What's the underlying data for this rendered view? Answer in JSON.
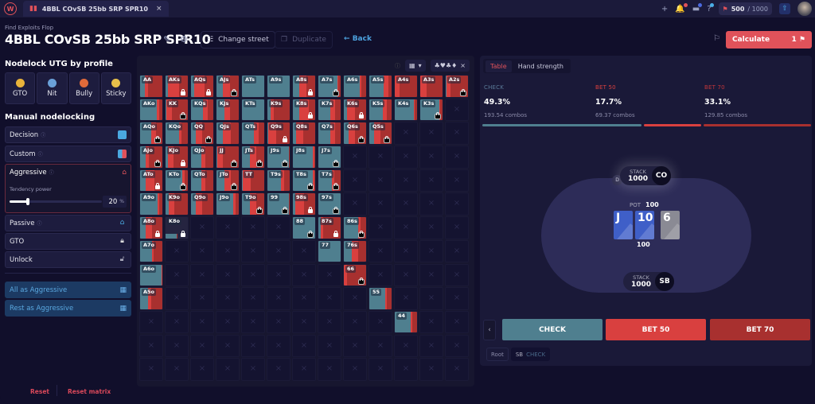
{
  "app": {
    "logo": "W",
    "tab": {
      "icon": "chart-icon",
      "title": "4BBL COvSB 25bb SRP SPR10",
      "close": "×"
    },
    "credits": {
      "used": "500",
      "max": "/ 1000"
    }
  },
  "header": {
    "subtitle": "Find Exploits Flop",
    "title": "4BBL COvSB 25bb SRP SPR10",
    "change_street": "Change street",
    "duplicate": "Duplicate",
    "back": "Back",
    "calculate": "Calculate",
    "calculate_count": "1"
  },
  "left": {
    "profile_heading": "Nodelock UTG by profile",
    "profiles": [
      {
        "label": "GTO",
        "emoji": "😎",
        "color": "#e8b33a"
      },
      {
        "label": "Nit",
        "emoji": "😱",
        "color": "#6aa0d8"
      },
      {
        "label": "Bully",
        "emoji": "😡",
        "color": "#e06a3a"
      },
      {
        "label": "Sticky",
        "emoji": "😬",
        "color": "#e8c04a"
      }
    ],
    "manual_heading": "Manual nodelocking",
    "rows": {
      "decision": "Decision",
      "custom": "Custom",
      "aggressive": "Aggressive",
      "passive": "Passive",
      "gto": "GTO",
      "unlock": "Unlock"
    },
    "tendency_label": "Tendency power",
    "tendency_value": "20",
    "tendency_unit": "%",
    "tendency_fraction": 0.2,
    "all_as": "All as Aggressive",
    "rest_as": "Rest as Aggressive",
    "reset": "Reset",
    "reset_matrix": "Reset matrix"
  },
  "matrix": {
    "colors": {
      "check": "#4f7f8f",
      "bet50": "#d9403f",
      "bet70": "#a8302f"
    },
    "rows": [
      [
        [
          "AA",
          0.2,
          0.15,
          0.65,
          ""
        ],
        [
          "AKs",
          0.1,
          0.5,
          0.4,
          "w"
        ],
        [
          "AQs",
          0.15,
          0.45,
          0.4,
          "w"
        ],
        [
          "AJs",
          0.3,
          0.3,
          0.4,
          "b"
        ],
        [
          "ATs",
          1,
          0,
          0,
          ""
        ],
        [
          "A9s",
          1,
          0,
          0,
          ""
        ],
        [
          "A8s",
          0.3,
          0.3,
          0.4,
          "w"
        ],
        [
          "A7s",
          0.85,
          0.05,
          0.1,
          "b"
        ],
        [
          "A6s",
          0.7,
          0.1,
          0.2,
          ""
        ],
        [
          "A5s",
          0.65,
          0.2,
          0.15,
          ""
        ],
        [
          "A4s",
          0,
          0.2,
          0.8,
          ""
        ],
        [
          "A3s",
          0,
          0.3,
          0.7,
          ""
        ],
        [
          "A2s",
          0.05,
          0.15,
          0.8,
          "b"
        ]
      ],
      [
        [
          "AKo",
          0.75,
          0.1,
          0.15,
          ""
        ],
        [
          "KK",
          0.05,
          0.25,
          0.7,
          "b"
        ],
        [
          "KQs",
          0.55,
          0.2,
          0.25,
          ""
        ],
        [
          "KJs",
          0.35,
          0.25,
          0.4,
          ""
        ],
        [
          "KTs",
          1,
          0,
          0,
          ""
        ],
        [
          "K9s",
          0.15,
          0.15,
          0.7,
          ""
        ],
        [
          "K8s",
          0.3,
          0.4,
          0.3,
          "w"
        ],
        [
          "K7s",
          0.55,
          0.2,
          0.25,
          ""
        ],
        [
          "K6s",
          0.15,
          0.35,
          0.5,
          "w"
        ],
        [
          "K5s",
          0.6,
          0.2,
          0.2,
          ""
        ],
        [
          "K4s",
          0.85,
          0.05,
          0.1,
          ""
        ],
        [
          "K3s",
          0.85,
          0.05,
          0.1,
          "b"
        ],
        [
          "",
          0,
          0,
          0,
          "empty"
        ]
      ],
      [
        [
          "AQo",
          0.5,
          0.2,
          0.3,
          "b"
        ],
        [
          "KQo",
          0.6,
          0.1,
          0.3,
          ""
        ],
        [
          "QQ",
          0.2,
          0.3,
          0.5,
          "b"
        ],
        [
          "QJs",
          0.3,
          0.35,
          0.35,
          ""
        ],
        [
          "QTs",
          0.55,
          0.2,
          0.25,
          ""
        ],
        [
          "Q9s",
          0.05,
          0.35,
          0.6,
          "w"
        ],
        [
          "Q8s",
          0.15,
          0.3,
          0.55,
          ""
        ],
        [
          "Q7s",
          0.55,
          0.2,
          0.25,
          ""
        ],
        [
          "Q6s",
          0.2,
          0.3,
          0.5,
          "b"
        ],
        [
          "Q5s",
          0.2,
          0.3,
          0.5,
          "b"
        ],
        [
          "",
          0,
          0,
          0,
          "empty"
        ],
        [
          "",
          0,
          0,
          0,
          "empty"
        ],
        [
          "",
          0,
          0,
          0,
          "empty"
        ]
      ],
      [
        [
          "AJo",
          0.25,
          0.15,
          0.6,
          "b"
        ],
        [
          "KJo",
          0.1,
          0.25,
          0.65,
          "w"
        ],
        [
          "QJo",
          0.45,
          0.2,
          0.35,
          ""
        ],
        [
          "JJ",
          0.05,
          0.25,
          0.7,
          "b"
        ],
        [
          "JTs",
          0.35,
          0.3,
          0.35,
          "b"
        ],
        [
          "J9s",
          0.95,
          0,
          0.05,
          "b"
        ],
        [
          "J8s",
          0.9,
          0.05,
          0.05,
          ""
        ],
        [
          "J7s",
          1,
          0,
          0,
          "b"
        ],
        [
          "",
          0,
          0,
          0,
          "empty"
        ],
        [
          "",
          0,
          0,
          0,
          "empty"
        ],
        [
          "",
          0,
          0,
          0,
          "empty"
        ],
        [
          "",
          0,
          0,
          0,
          "empty"
        ],
        [
          "",
          0,
          0,
          0,
          "empty"
        ]
      ],
      [
        [
          "ATo",
          0.25,
          0.4,
          0.35,
          "w"
        ],
        [
          "KTo",
          0.75,
          0.1,
          0.15,
          "b"
        ],
        [
          "QTo",
          0.45,
          0.2,
          0.35,
          ""
        ],
        [
          "JTo",
          0.35,
          0.3,
          0.35,
          "b"
        ],
        [
          "TT",
          0.05,
          0.35,
          0.6,
          ""
        ],
        [
          "T9s",
          0.6,
          0.15,
          0.25,
          ""
        ],
        [
          "T8s",
          0.9,
          0.05,
          0.05,
          "b"
        ],
        [
          "T7s",
          0.6,
          0.1,
          0.3,
          "b"
        ],
        [
          "",
          0,
          0,
          0,
          "empty"
        ],
        [
          "",
          0,
          0,
          0,
          "empty"
        ],
        [
          "",
          0,
          0,
          0,
          "empty"
        ],
        [
          "",
          0,
          0,
          0,
          "empty"
        ],
        [
          "",
          0,
          0,
          0,
          "empty"
        ]
      ],
      [
        [
          "A9o",
          0.8,
          0.05,
          0.15,
          ""
        ],
        [
          "K9o",
          0.15,
          0.25,
          0.6,
          ""
        ],
        [
          "Q9o",
          0.2,
          0.3,
          0.5,
          ""
        ],
        [
          "J9o",
          0.75,
          0.1,
          0.15,
          ""
        ],
        [
          "T9o",
          0.35,
          0.3,
          0.35,
          "b"
        ],
        [
          "99",
          0.95,
          0,
          0.05,
          "b"
        ],
        [
          "98s",
          0.1,
          0.4,
          0.5,
          "w"
        ],
        [
          "97s",
          1,
          0,
          0,
          "b"
        ],
        [
          "",
          0,
          0,
          0,
          "empty"
        ],
        [
          "",
          0,
          0,
          0,
          "empty"
        ],
        [
          "",
          0,
          0,
          0,
          "empty"
        ],
        [
          "",
          0,
          0,
          0,
          "empty"
        ],
        [
          "",
          0,
          0,
          0,
          "empty"
        ]
      ],
      [
        [
          "A8o",
          0.25,
          0.3,
          0.45,
          "w"
        ],
        [
          "K8o",
          0.5,
          0,
          0.05,
          "w"
        ],
        [
          "",
          0,
          0,
          0,
          "empty"
        ],
        [
          "",
          0,
          0,
          0,
          "empty"
        ],
        [
          "",
          0,
          0,
          0,
          "empty"
        ],
        [
          "",
          0,
          0,
          0,
          "empty"
        ],
        [
          "88",
          1,
          0,
          0,
          "b"
        ],
        [
          "87s",
          0.1,
          0.1,
          0.8,
          "w"
        ],
        [
          "86s",
          0.65,
          0.1,
          0.25,
          "b"
        ],
        [
          "",
          0,
          0,
          0,
          "empty"
        ],
        [
          "",
          0,
          0,
          0,
          "empty"
        ],
        [
          "",
          0,
          0,
          0,
          "empty"
        ],
        [
          "",
          0,
          0,
          0,
          "empty"
        ]
      ],
      [
        [
          "A7o",
          0.55,
          0.05,
          0.4,
          ""
        ],
        [
          "",
          0,
          0,
          0,
          "empty"
        ],
        [
          "",
          0,
          0,
          0,
          "empty"
        ],
        [
          "",
          0,
          0,
          0,
          "empty"
        ],
        [
          "",
          0,
          0,
          0,
          "empty"
        ],
        [
          "",
          0,
          0,
          0,
          "empty"
        ],
        [
          "",
          0,
          0,
          0,
          "empty"
        ],
        [
          "77",
          1,
          0,
          0,
          ""
        ],
        [
          "76s",
          0.35,
          0.3,
          0.35,
          ""
        ],
        [
          "",
          0,
          0,
          0,
          "empty"
        ],
        [
          "",
          0,
          0,
          0,
          "empty"
        ],
        [
          "",
          0,
          0,
          0,
          "empty"
        ],
        [
          "",
          0,
          0,
          0,
          "empty"
        ]
      ],
      [
        [
          "A6o",
          0.95,
          0.05,
          0,
          ""
        ],
        [
          "",
          0,
          0,
          0,
          "empty"
        ],
        [
          "",
          0,
          0,
          0,
          "empty"
        ],
        [
          "",
          0,
          0,
          0,
          "empty"
        ],
        [
          "",
          0,
          0,
          0,
          "empty"
        ],
        [
          "",
          0,
          0,
          0,
          "empty"
        ],
        [
          "",
          0,
          0,
          0,
          "empty"
        ],
        [
          "",
          0,
          0,
          0,
          "empty"
        ],
        [
          "66",
          0,
          0.15,
          0.85,
          "b"
        ],
        [
          "",
          0,
          0,
          0,
          "empty"
        ],
        [
          "",
          0,
          0,
          0,
          "empty"
        ],
        [
          "",
          0,
          0,
          0,
          "empty"
        ],
        [
          "",
          0,
          0,
          0,
          "empty"
        ]
      ],
      [
        [
          "A5o",
          0.35,
          0.15,
          0.5,
          ""
        ],
        [
          "",
          0,
          0,
          0,
          "empty"
        ],
        [
          "",
          0,
          0,
          0,
          "empty"
        ],
        [
          "",
          0,
          0,
          0,
          "empty"
        ],
        [
          "",
          0,
          0,
          0,
          "empty"
        ],
        [
          "",
          0,
          0,
          0,
          "empty"
        ],
        [
          "",
          0,
          0,
          0,
          "empty"
        ],
        [
          "",
          0,
          0,
          0,
          "empty"
        ],
        [
          "",
          0,
          0,
          0,
          "empty"
        ],
        [
          "55",
          0.7,
          0.1,
          0.2,
          ""
        ],
        [
          "",
          0,
          0,
          0,
          "empty"
        ],
        [
          "",
          0,
          0,
          0,
          "empty"
        ],
        [
          "",
          0,
          0,
          0,
          "empty"
        ]
      ],
      [
        [
          "",
          0,
          0,
          0,
          "empty"
        ],
        [
          "",
          0,
          0,
          0,
          "empty"
        ],
        [
          "",
          0,
          0,
          0,
          "empty"
        ],
        [
          "",
          0,
          0,
          0,
          "empty"
        ],
        [
          "",
          0,
          0,
          0,
          "empty"
        ],
        [
          "",
          0,
          0,
          0,
          "empty"
        ],
        [
          "",
          0,
          0,
          0,
          "empty"
        ],
        [
          "",
          0,
          0,
          0,
          "empty"
        ],
        [
          "",
          0,
          0,
          0,
          "empty"
        ],
        [
          "",
          0,
          0,
          0,
          "empty"
        ],
        [
          "44",
          0.7,
          0.1,
          0.2,
          ""
        ],
        [
          "",
          0,
          0,
          0,
          "empty"
        ],
        [
          "",
          0,
          0,
          0,
          "empty"
        ]
      ],
      [
        [
          "",
          0,
          0,
          0,
          "empty"
        ],
        [
          "",
          0,
          0,
          0,
          "empty"
        ],
        [
          "",
          0,
          0,
          0,
          "empty"
        ],
        [
          "",
          0,
          0,
          0,
          "empty"
        ],
        [
          "",
          0,
          0,
          0,
          "empty"
        ],
        [
          "",
          0,
          0,
          0,
          "empty"
        ],
        [
          "",
          0,
          0,
          0,
          "empty"
        ],
        [
          "",
          0,
          0,
          0,
          "empty"
        ],
        [
          "",
          0,
          0,
          0,
          "empty"
        ],
        [
          "",
          0,
          0,
          0,
          "empty"
        ],
        [
          "",
          0,
          0,
          0,
          "empty"
        ],
        [
          "",
          0,
          0,
          0,
          "empty"
        ],
        [
          "",
          0,
          0,
          0,
          "empty"
        ]
      ],
      [
        [
          "",
          0,
          0,
          0,
          "empty"
        ],
        [
          "",
          0,
          0,
          0,
          "empty"
        ],
        [
          "",
          0,
          0,
          0,
          "empty"
        ],
        [
          "",
          0,
          0,
          0,
          "empty"
        ],
        [
          "",
          0,
          0,
          0,
          "empty"
        ],
        [
          "",
          0,
          0,
          0,
          "empty"
        ],
        [
          "",
          0,
          0,
          0,
          "empty"
        ],
        [
          "",
          0,
          0,
          0,
          "empty"
        ],
        [
          "",
          0,
          0,
          0,
          "empty"
        ],
        [
          "",
          0,
          0,
          0,
          "empty"
        ],
        [
          "",
          0,
          0,
          0,
          "empty"
        ],
        [
          "",
          0,
          0,
          0,
          "empty"
        ],
        [
          "",
          0,
          0,
          0,
          "empty"
        ]
      ]
    ]
  },
  "right": {
    "tabs": [
      "Table",
      "Hand strength"
    ],
    "active_tab": "Table",
    "stats": [
      {
        "action": "CHECK",
        "pct": "49.3%",
        "combos": "193.54 combos",
        "fraction": 0.493,
        "color": "#4f7f8f",
        "label_color": "#5a7a98"
      },
      {
        "action": "BET 50",
        "pct": "17.7%",
        "combos": "69.37 combos",
        "fraction": 0.177,
        "color": "#d9403f",
        "label_color": "#d9403f"
      },
      {
        "action": "BET 70",
        "pct": "33.1%",
        "combos": "129.85 combos",
        "fraction": 0.331,
        "color": "#a8302f",
        "label_color": "#c0353a"
      }
    ],
    "table": {
      "top_seat": {
        "stack_label": "STACK",
        "stack": "1000",
        "pos": "CO",
        "dealer": "D"
      },
      "bottom_seat": {
        "stack_label": "STACK",
        "stack": "1000",
        "pos": "SB"
      },
      "pot_label": "POT",
      "pot": "100",
      "pot_below": "100",
      "board": [
        {
          "rank": "J",
          "color": "#3f5fc8"
        },
        {
          "rank": "10",
          "color": "#3f5fc8"
        },
        {
          "rank": "6",
          "color": "#8a8a94"
        }
      ]
    },
    "actions": [
      {
        "label": "CHECK",
        "color": "#4f7f8f"
      },
      {
        "label": "BET 50",
        "color": "#d9403f"
      },
      {
        "label": "BET 70",
        "color": "#a8302f"
      }
    ],
    "breadcrumbs": {
      "root": "Root",
      "player": "SB",
      "action": "CHECK"
    }
  }
}
